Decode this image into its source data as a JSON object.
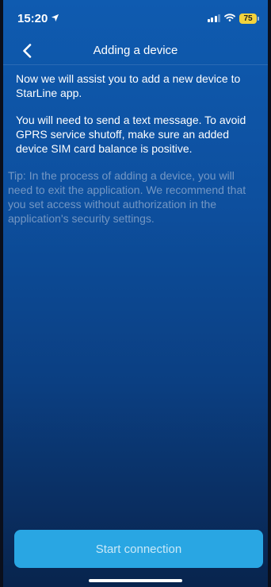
{
  "status_bar": {
    "time": "15:20",
    "battery": "75",
    "icons": [
      "location-arrow-icon",
      "cellular-signal-icon",
      "wifi-icon",
      "battery-icon"
    ]
  },
  "nav": {
    "title": "Adding a device",
    "back_icon": "chevron-left-icon"
  },
  "content": {
    "paragraph_1": "Now we will assist you to add a new device to StarLine app.",
    "paragraph_2": "You will need to send a text message. To avoid GPRS service shutoff, make sure an added device SIM card balance is positive.",
    "tip": "Tip: In the process of adding a device, you will need to exit the application. We recommend that you set access without authorization in the application's security settings."
  },
  "actions": {
    "start_label": "Start connection"
  },
  "colors": {
    "gradient_top": "#0f5bb0",
    "gradient_bottom": "#08244d",
    "button": "#29a6e3",
    "battery": "#f2d23c"
  }
}
